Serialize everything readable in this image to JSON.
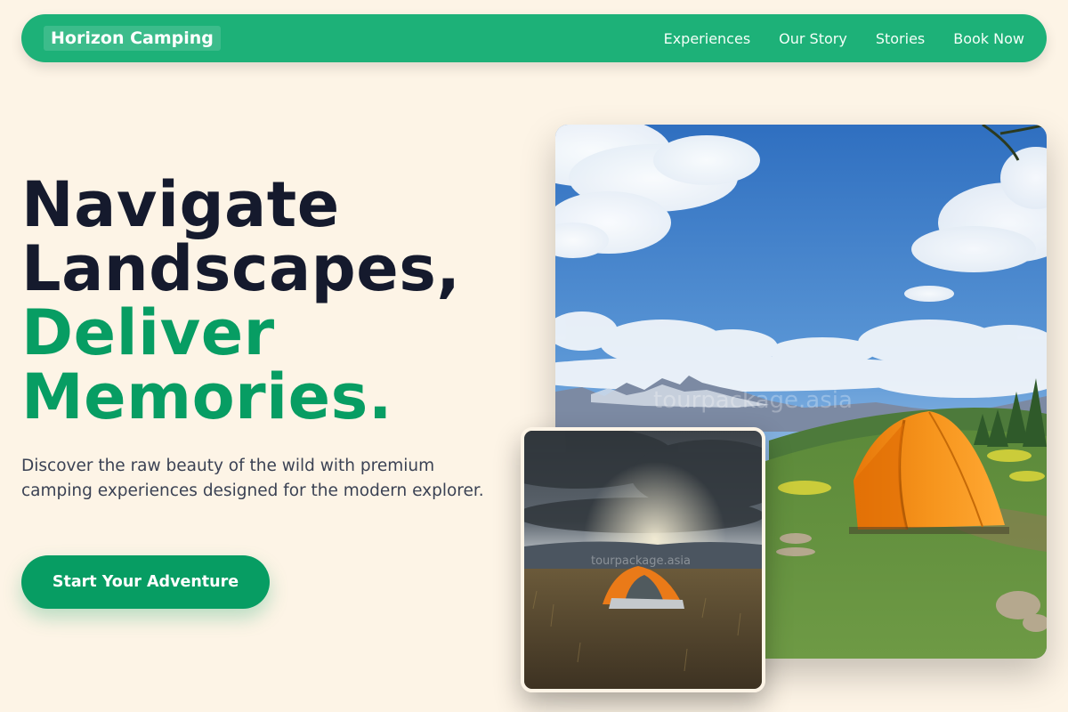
{
  "nav": {
    "brand": "Horizon Camping",
    "links": [
      "Experiences",
      "Our Story",
      "Stories",
      "Book Now"
    ]
  },
  "hero": {
    "headline_line1": "Navigate",
    "headline_line2": "Landscapes,",
    "headline_line3": "Deliver",
    "headline_line4": "Memories.",
    "subtext": "Discover the raw beauty of the wild with premium camping experiences designed for the modern explorer.",
    "cta_label": "Start Your Adventure"
  },
  "images": {
    "main_watermark": "tourpackage.asia",
    "inset_watermark": "tourpackage.asia"
  },
  "colors": {
    "background": "#fdf4e6",
    "nav": "#1db178",
    "accent": "#079d63",
    "headline_dark": "#151a2d"
  }
}
